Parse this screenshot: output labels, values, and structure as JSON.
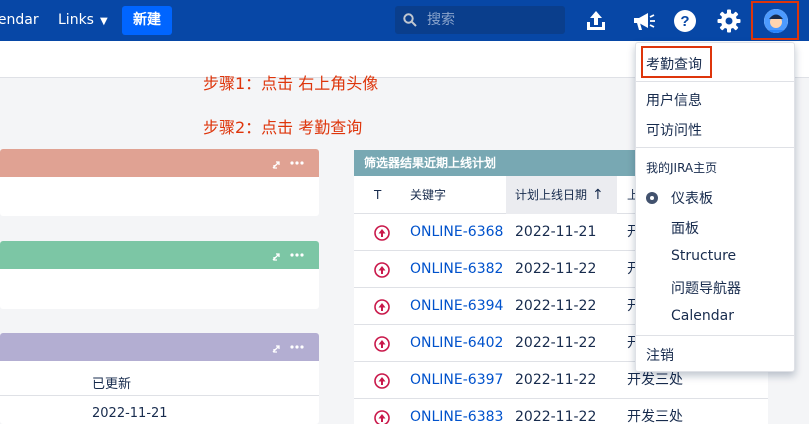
{
  "topnav": {
    "calendar_label": "lendar",
    "links_label": "Links",
    "create_label": "新建",
    "search_placeholder": "搜索",
    "icons": [
      "upload-icon",
      "megaphone-icon",
      "help-icon",
      "gear-icon",
      "avatar"
    ],
    "brand_color": "#0747a6"
  },
  "annotations": {
    "step1": "步骤1：点击  右上角头像",
    "step2": "步骤2：点击  考勤查询"
  },
  "left_gadgets": {
    "header_colors": [
      "#e0a293",
      "#7cc6a5",
      "#b3aed2"
    ],
    "g3_col_label": "已更新",
    "g3_row_value": "2022-11-21"
  },
  "filter_gadget": {
    "title": "筛选器结果近期上线计划",
    "columns": [
      "T",
      "关键字",
      "计划上线日期",
      "上"
    ],
    "rows": [
      {
        "key": "ONLINE-6368",
        "date": "2022-11-21",
        "dept": "开"
      },
      {
        "key": "ONLINE-6382",
        "date": "2022-11-22",
        "dept": "开"
      },
      {
        "key": "ONLINE-6394",
        "date": "2022-11-22",
        "dept": "开"
      },
      {
        "key": "ONLINE-6402",
        "date": "2022-11-22",
        "dept": "开"
      },
      {
        "key": "ONLINE-6397",
        "date": "2022-11-22",
        "dept": "开发三处"
      },
      {
        "key": "ONLINE-6383",
        "date": "2022-11-22",
        "dept": "开发三处"
      }
    ]
  },
  "user_menu": {
    "attendance": "考勤查询",
    "profile": "用户信息",
    "accessibility": "可访问性",
    "my_jira_home": "我的JIRA主页",
    "dashboard": "仪表板",
    "boards": "面板",
    "structure": "Structure",
    "issue_navigator": "问题导航器",
    "calendar": "Calendar",
    "logout": "注销"
  }
}
